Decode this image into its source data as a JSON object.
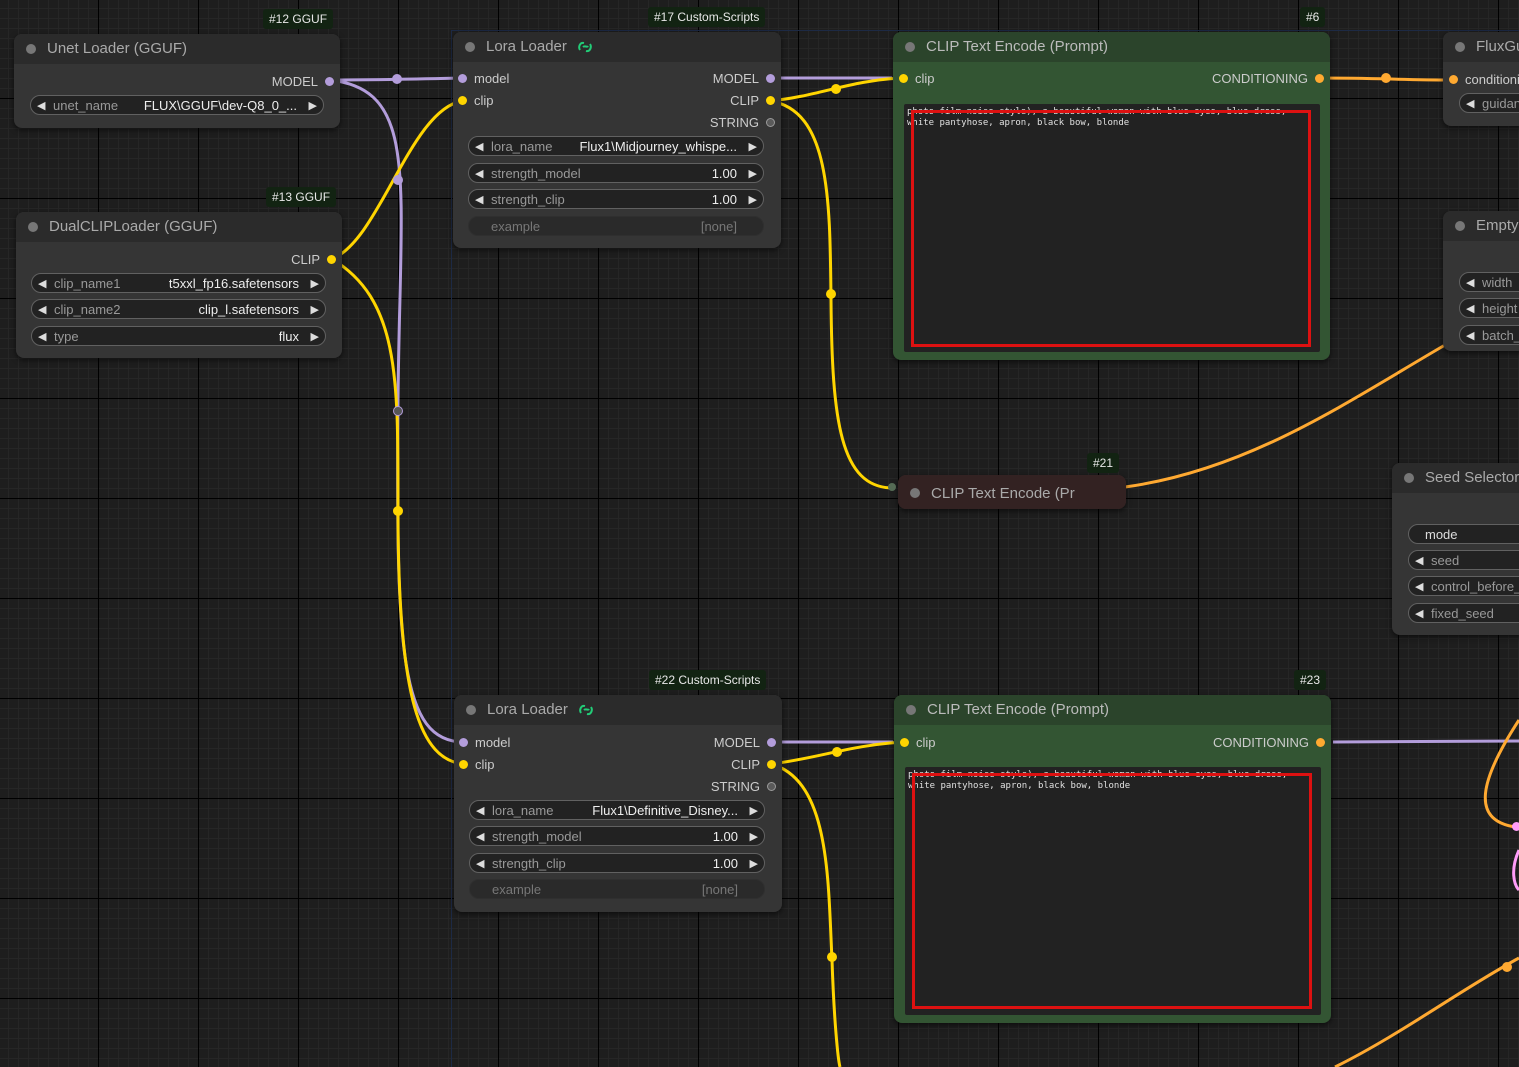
{
  "colors": {
    "model": "#b39ddb",
    "clip": "#ffd500",
    "conditioning": "#ffa931",
    "latent": "#ff9cf9",
    "green_node": "#335533",
    "highlight": "#dd1111"
  },
  "nodes": {
    "unet": {
      "badge": "#12 GGUF",
      "title": "Unet Loader (GGUF)",
      "out_model": "MODEL",
      "w_name": "unet_name",
      "w_value": "FLUX\\GGUF\\dev-Q8_0_..."
    },
    "dualclip": {
      "badge": "#13 GGUF",
      "title": "DualCLIPLoader (GGUF)",
      "out_clip": "CLIP",
      "w1_name": "clip_name1",
      "w1_value": "t5xxl_fp16.safetensors",
      "w2_name": "clip_name2",
      "w2_value": "clip_l.safetensors",
      "w3_name": "type",
      "w3_value": "flux"
    },
    "lora17": {
      "badge": "#17 Custom-Scripts",
      "title": "Lora Loader",
      "icon": "link-icon",
      "in_model": "model",
      "in_clip": "clip",
      "out_model": "MODEL",
      "out_clip": "CLIP",
      "out_string": "STRING",
      "w1_name": "lora_name",
      "w1_value": "Flux1\\Midjourney_whispe...",
      "w2_name": "strength_model",
      "w2_value": "1.00",
      "w3_name": "strength_clip",
      "w3_value": "1.00",
      "w4_name": "example",
      "w4_value": "[none]"
    },
    "clip6": {
      "badge": "#6",
      "title": "CLIP Text Encode (Prompt)",
      "in_clip": "clip",
      "out_cond": "CONDITIONING",
      "text": "photo film noise style), a beautiful woman with blue eyes, blue dress, white pantyhose, apron, black bow, blonde"
    },
    "flux": {
      "title": "FluxGu",
      "in_cond": "conditioni",
      "w1_name": "guidan"
    },
    "empty": {
      "title": "Empty",
      "w1_name": "width",
      "w2_name": "height",
      "w3_name": "batch_"
    },
    "clip21": {
      "badge": "#21",
      "title": "CLIP Text Encode (Pr"
    },
    "seed": {
      "title": "Seed Selector",
      "w1_name": "mode",
      "w2_name": "seed",
      "w3_name": "control_before_",
      "w4_name": "fixed_seed"
    },
    "lora22": {
      "badge": "#22 Custom-Scripts",
      "title": "Lora Loader",
      "icon": "link-icon",
      "in_model": "model",
      "in_clip": "clip",
      "out_model": "MODEL",
      "out_clip": "CLIP",
      "out_string": "STRING",
      "w1_name": "lora_name",
      "w1_value": "Flux1\\Definitive_Disney...",
      "w2_name": "strength_model",
      "w2_value": "1.00",
      "w3_name": "strength_clip",
      "w3_value": "1.00",
      "w4_name": "example",
      "w4_value": "[none]"
    },
    "clip23": {
      "badge": "#23",
      "title": "CLIP Text Encode (Prompt)",
      "in_clip": "clip",
      "out_cond": "CONDITIONING",
      "text": "photo film noise style), a beautiful woman with blue eyes, blue dress, white pantyhose, apron, black bow, blonde"
    }
  }
}
